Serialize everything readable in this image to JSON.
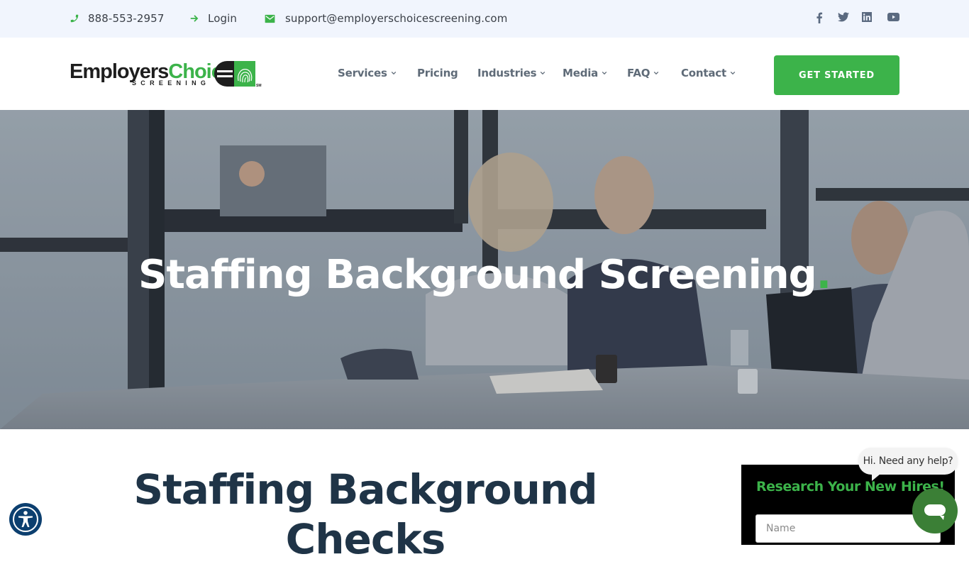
{
  "topbar": {
    "phone": "888-553-2957",
    "login": "Login",
    "email": "support@employerschoicescreening.com",
    "social": [
      "facebook",
      "twitter",
      "linkedin",
      "youtube"
    ]
  },
  "header": {
    "logo": {
      "word1": "Employers",
      "word2": "Choice",
      "sub": "SCREENING",
      "sm": "SM"
    },
    "nav": [
      {
        "label": "Services",
        "dropdown": true
      },
      {
        "label": "Pricing",
        "dropdown": false
      },
      {
        "label": "Industries",
        "dropdown": true
      },
      {
        "label": "Media",
        "dropdown": true
      },
      {
        "label": "FAQ",
        "dropdown": true
      },
      {
        "label": "Contact",
        "dropdown": true
      }
    ],
    "cta": "GET STARTED"
  },
  "hero": {
    "title": "Staffing Background Screening",
    "title_dot": "."
  },
  "content": {
    "title_line1": "Staffing Background",
    "title_line2": "Checks"
  },
  "research": {
    "title": "Research Your New Hires!",
    "name_placeholder": "Name"
  },
  "chat": {
    "bubble": "Hi. Need any help?"
  },
  "colors": {
    "accent": "#3cb34a",
    "topbar_bg": "#f1f5fd",
    "heading": "#1f3447",
    "nav_text": "#5f6b78",
    "chat_green": "#3b7f36",
    "a11y_blue": "#0c3f6f"
  }
}
